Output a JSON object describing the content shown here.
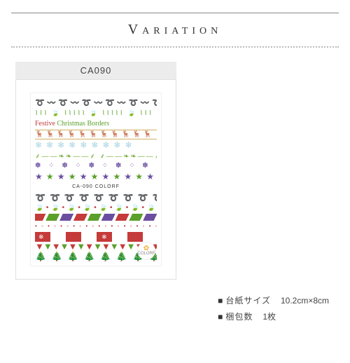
{
  "header": {
    "title": "Variation"
  },
  "product": {
    "code": "CA090",
    "sheet_code_line": "CA-090",
    "brand": "COLORF",
    "festive_line": "Festive",
    "festive_line_2": "Christmas Borders"
  },
  "specs": {
    "row1": {
      "bullet": "■",
      "label": "台紙サイズ",
      "value": "10.2cm×8cm"
    },
    "row2": {
      "bullet": "■",
      "label": "梱包数",
      "value": "1枚"
    }
  }
}
